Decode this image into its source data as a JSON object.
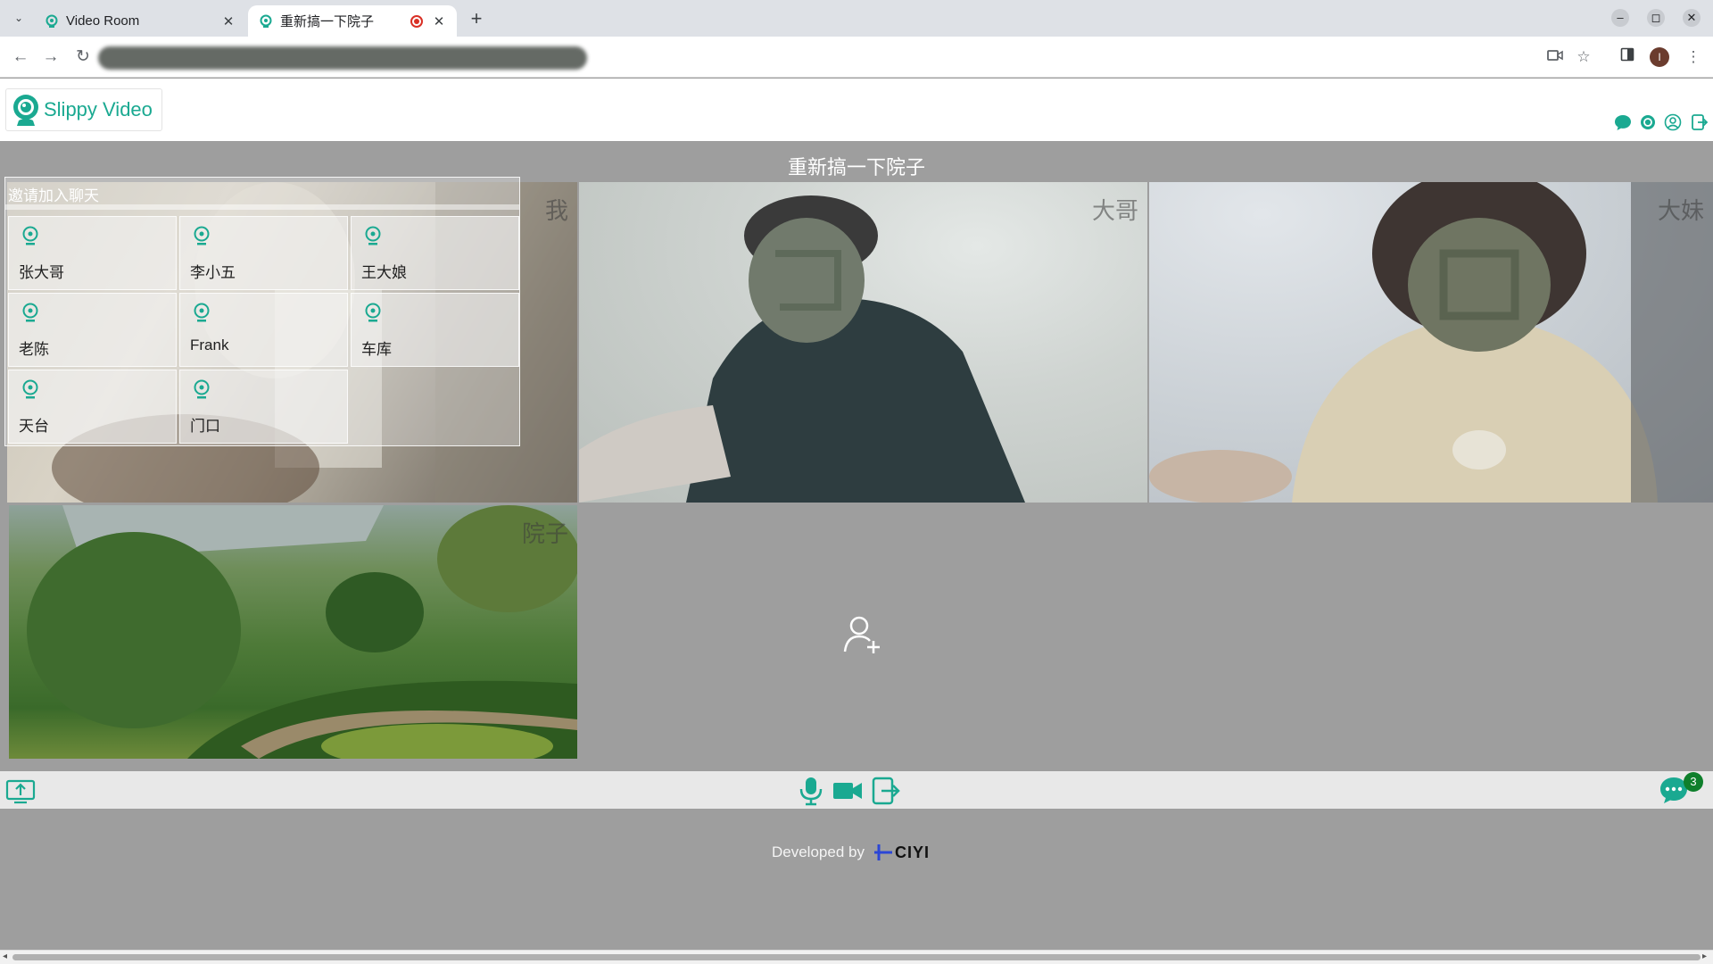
{
  "browser": {
    "tabs": [
      {
        "title": "Video Room",
        "active": false
      },
      {
        "title": "重新搞一下院子",
        "active": true,
        "recording": true
      }
    ],
    "new_tab": "+",
    "profile_initial": "I"
  },
  "app": {
    "brand_name": "Slippy Video",
    "accent_color": "#1aa991",
    "header_icons": [
      "chat-icon",
      "settings-icon",
      "user-icon",
      "logout-icon"
    ]
  },
  "room": {
    "title": "重新搞一下院子",
    "participants": [
      {
        "name": "我"
      },
      {
        "name": "大哥"
      },
      {
        "name": "大妹"
      },
      {
        "name": "院子"
      }
    ]
  },
  "invite": {
    "title": "邀请加入聊天",
    "contacts": [
      "张大哥",
      "李小五",
      "王大娘",
      "老陈",
      "Frank",
      "车库",
      "天台",
      "门口"
    ]
  },
  "controls": {
    "icons": [
      "screen-share-icon",
      "microphone-icon",
      "camera-icon",
      "leave-icon",
      "chat-icon"
    ],
    "chat_unread": "3"
  },
  "footer": {
    "developed_by": "Developed by",
    "company": "CIYI"
  }
}
